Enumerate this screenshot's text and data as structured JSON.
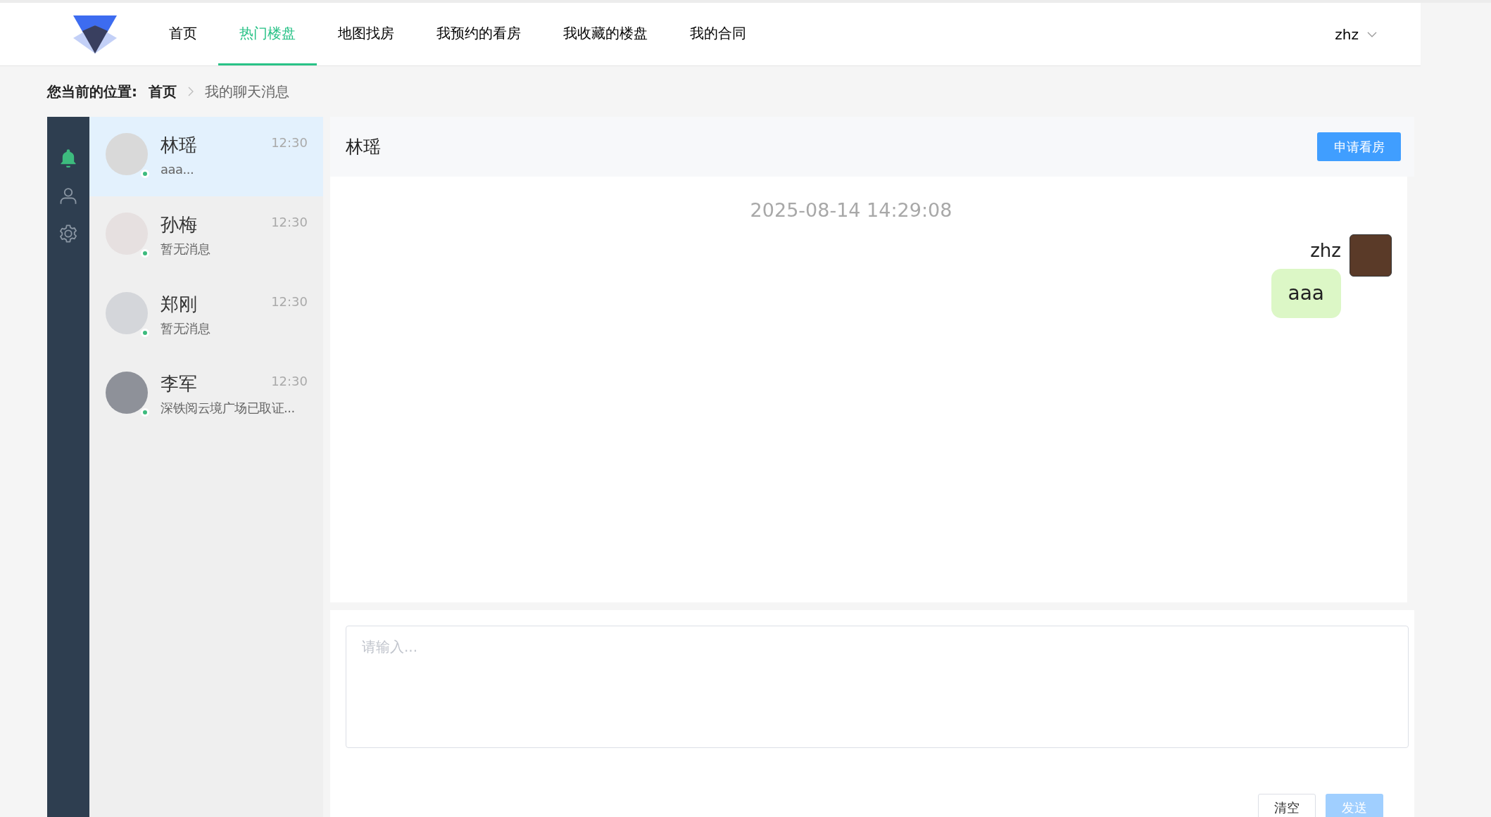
{
  "nav": {
    "tabs": [
      {
        "label": "首页",
        "selected": false
      },
      {
        "label": "热门楼盘",
        "selected": true
      },
      {
        "label": "地图找房",
        "selected": false
      },
      {
        "label": "我预约的看房",
        "selected": false
      },
      {
        "label": "我收藏的楼盘",
        "selected": false
      },
      {
        "label": "我的合同",
        "selected": false
      }
    ],
    "user": "zhz"
  },
  "breadcrumb": {
    "label": "您当前的位置:",
    "items": [
      "首页",
      "我的聊天消息"
    ]
  },
  "sidebar": {
    "items": [
      {
        "kind": "bell",
        "selected": true
      },
      {
        "kind": "user",
        "selected": false
      },
      {
        "kind": "settings",
        "selected": false
      }
    ]
  },
  "contacts": [
    {
      "name": "林瑶",
      "time": "12:30",
      "preview": "aaa...",
      "online": true,
      "selected": true
    },
    {
      "name": "孙梅",
      "time": "12:30",
      "preview": "暂无消息",
      "online": true,
      "selected": false
    },
    {
      "name": "郑刚",
      "time": "12:30",
      "preview": "暂无消息",
      "online": true,
      "selected": false
    },
    {
      "name": "李军",
      "time": "12:30",
      "preview": "深铁阅云境广场已取证...",
      "online": true,
      "selected": false
    }
  ],
  "chat": {
    "title": "林瑶",
    "action": "申请看房",
    "messages": [
      {
        "kind": "timestamp",
        "text": "2025-08-14 14:29:08"
      },
      {
        "kind": "outgoing",
        "sender": "zhz",
        "text": "aaa"
      }
    ],
    "input": {
      "placeholder": "请输入..."
    },
    "buttons": [
      {
        "label": "清空",
        "disabled": false
      },
      {
        "label": "发送",
        "disabled": true
      }
    ]
  }
}
